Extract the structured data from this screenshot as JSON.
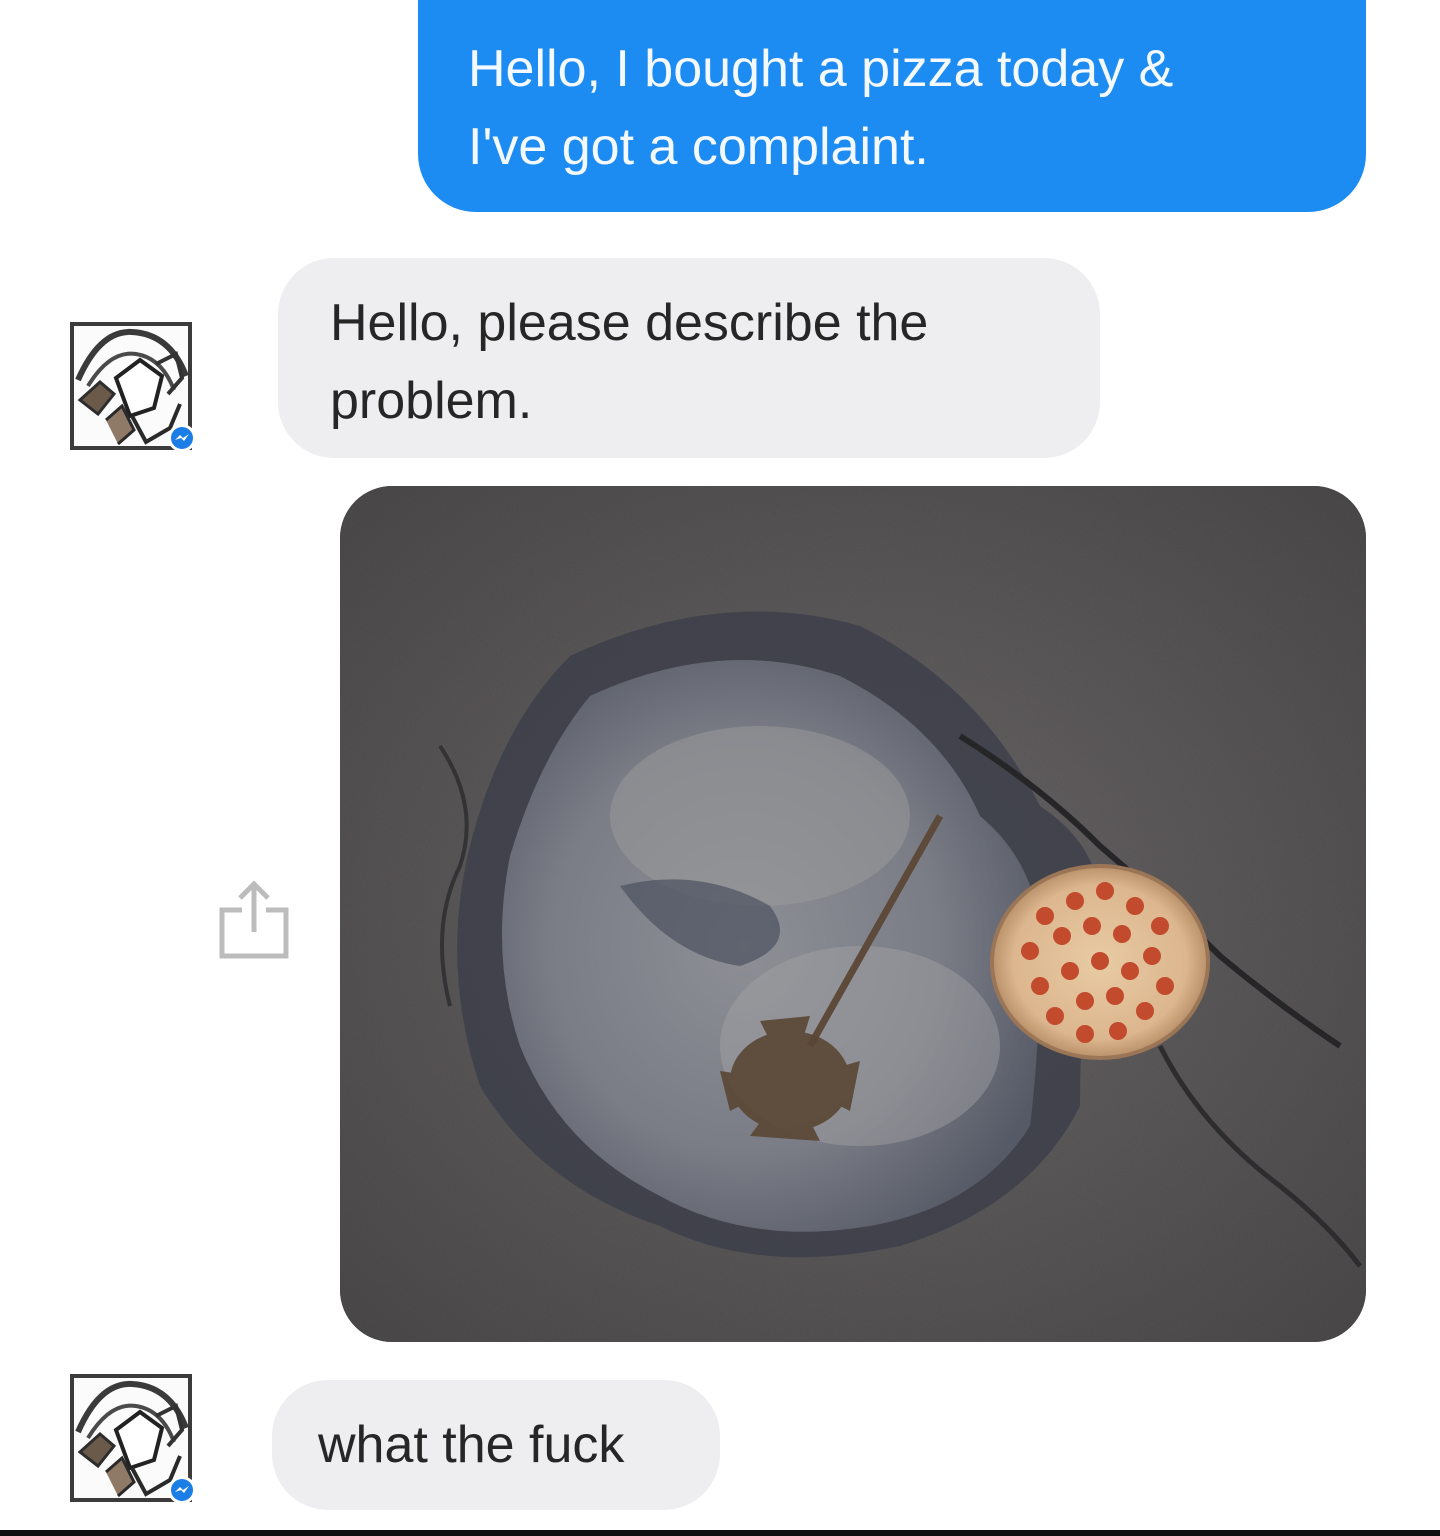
{
  "conversation": {
    "messages": [
      {
        "direction": "outgoing",
        "lines": [
          "Hello, I bought a pizza today &",
          "I've got a complaint."
        ]
      },
      {
        "direction": "incoming",
        "lines": [
          "Hello, please describe the",
          "problem."
        ]
      },
      {
        "direction": "incoming",
        "type": "photo",
        "photo_subject": "pizza-next-to-pothole-puddle"
      },
      {
        "direction": "incoming",
        "lines": [
          "what the fuck"
        ]
      }
    ]
  },
  "colors": {
    "outgoing_bubble": "#1d8cf2",
    "incoming_bubble": "#eeeef0",
    "messenger_badge": "#1a7ee6"
  },
  "icons": {
    "avatar": "pizza-hut-logo-avatar",
    "badge": "messenger-badge-icon",
    "share": "share-icon"
  }
}
